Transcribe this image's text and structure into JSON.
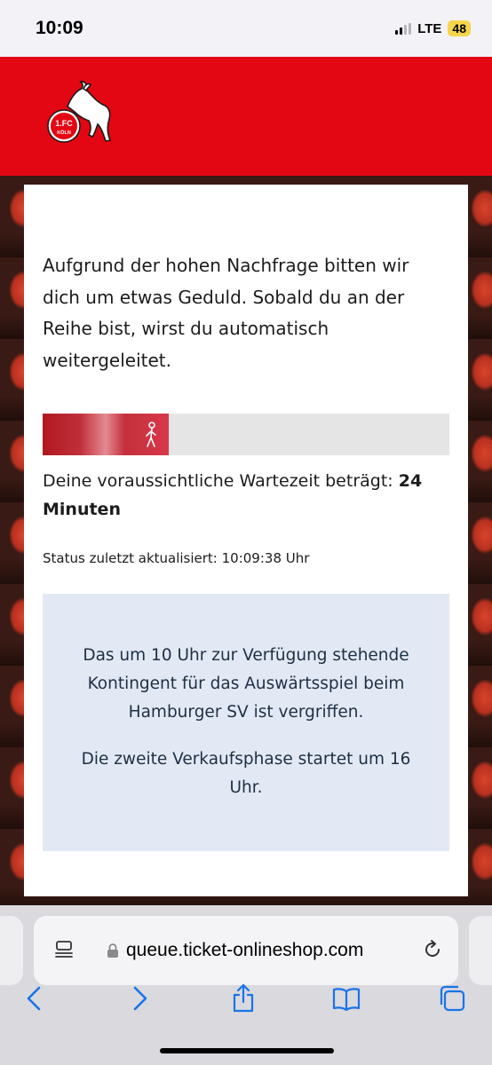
{
  "status_bar": {
    "time": "10:09",
    "network": "LTE",
    "battery": "48"
  },
  "header": {
    "logo_text_top": "1.FC",
    "logo_text_bottom": "KÖLN",
    "brand_color": "#e30613"
  },
  "queue": {
    "intro": "Aufgrund der hohen Nachfrage bitten wir dich um etwas Geduld. Sobald du an der Reihe bist, wirst du automatisch weitergeleitet.",
    "progress": 0.31,
    "wait_prefix": "Deine voraussichtliche Wartezeit beträgt: ",
    "wait_value": "24 Minuten",
    "status": "Status zuletzt aktualisiert: 10:09:38 Uhr",
    "info_paragraph_1": "Das um 10 Uhr zur Verfügung stehende Kontingent für das Auswärtsspiel beim Hamburger SV ist vergriffen.",
    "info_paragraph_2": "Die zweite Verkaufsphase startet um 16 Uhr."
  },
  "browser": {
    "url": "queue.ticket-onlineshop.com",
    "accent_color": "#1a73e8"
  }
}
